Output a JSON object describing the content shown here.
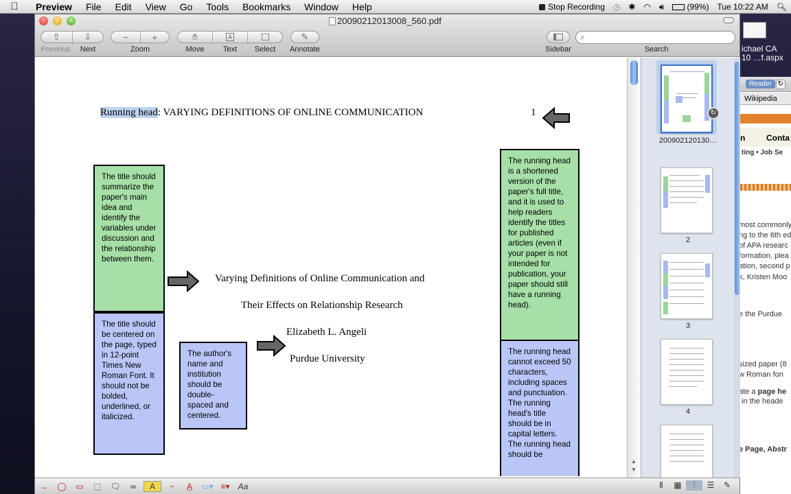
{
  "menubar": {
    "app": "Preview",
    "items": [
      "File",
      "Edit",
      "View",
      "Go",
      "Tools",
      "Bookmarks",
      "Window",
      "Help"
    ],
    "status": {
      "recording": "Stop Recording",
      "battery": "(99%)",
      "clock": "Tue 10:22 AM"
    }
  },
  "desktop": {
    "file_label_1": "ichael CA",
    "file_label_2": "10 …f.aspx"
  },
  "browser": {
    "reader": "Reader",
    "bookmark": "Wikipedia",
    "nav_1": "n",
    "nav_2": "Conta",
    "sub": "ting • Job Se",
    "lines": [
      "most commonly",
      "ng to the 6th ed",
      "of APA researc",
      "formation, plea",
      "ation, second p",
      "k, Kristen Moo",
      "e the Purdue",
      "sized paper (8",
      "w Roman fon",
      "ate a",
      "page he",
      "in the heade",
      "e Page,",
      "Abstr"
    ]
  },
  "window": {
    "title": "20090212013008_560.pdf",
    "toolbar": {
      "previous": "Previous",
      "next": "Next",
      "zoom": "Zoom",
      "move": "Move",
      "text": "Text",
      "select": "Select",
      "annotate": "Annotate",
      "sidebar": "Sidebar",
      "search": "Search",
      "search_placeholder": ""
    }
  },
  "document": {
    "running_head_highlight": "Running head",
    "running_head_rest": ": VARYING DEFINITIONS OF ONLINE COMMUNICATION",
    "page_number": "1",
    "title_line1": "Varying Definitions of Online Communication and",
    "title_line2": "Their Effects on Relationship Research",
    "author": "Elizabeth L. Angeli",
    "institution": "Purdue University",
    "box_title_summary": "The title should summarize the paper's main idea and identify the variables under discussion and the relationship between them.",
    "box_title_format": "The title should be centered on the page, typed in 12-point Times New Roman Font. It should not be bolded, underlined, or italicized.",
    "box_author": "The author's name and institution should be double-spaced and centered.",
    "box_running_head": "The running head is a shortened version of the paper's full title, and it is used to help readers identify the titles for published articles (even if your paper is not intended for publication, your paper should still have a running head).",
    "box_running_head_limit": "The running head cannot exceed 50 characters, including spaces and punctuation. The running head's title should be in capital letters. The running head should be"
  },
  "sidebar_thumbs": {
    "selected_label": "200902120130…",
    "pages": [
      "2",
      "3",
      "4"
    ]
  },
  "colors": {
    "green_box": "#a6dfa8",
    "blue_box": "#b9c6f7",
    "highlight": "#bcd2ee"
  }
}
